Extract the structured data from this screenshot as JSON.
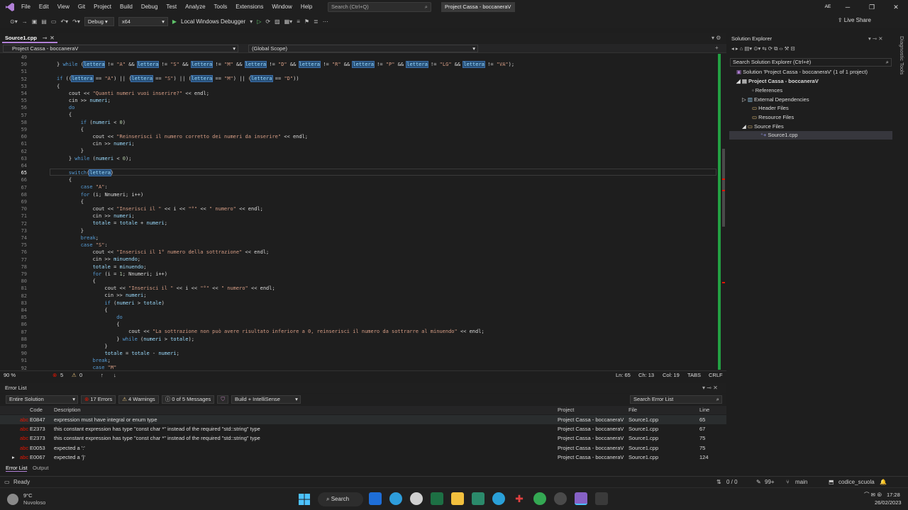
{
  "menubar": {
    "items": [
      "File",
      "Edit",
      "View",
      "Git",
      "Project",
      "Build",
      "Debug",
      "Test",
      "Analyze",
      "Tools",
      "Extensions",
      "Window",
      "Help"
    ],
    "search_placeholder": "Search (Ctrl+Q)",
    "project_title": "Project Cassa - boccaneraV",
    "avatar": "AE"
  },
  "toolbar": {
    "config": "Debug",
    "platform": "x64",
    "run_label": "Local Windows Debugger",
    "live_share": "Live Share"
  },
  "tabs": {
    "active": "Source1.cpp",
    "project_dropdown": "Project Cassa - boccaneraV",
    "scope_dropdown": "(Global Scope)"
  },
  "code": {
    "line_numbers": [
      "49",
      "50",
      "51",
      "52",
      "53",
      "54",
      "55",
      "56",
      "57",
      "58",
      "59",
      "60",
      "61",
      "62",
      "63",
      "64",
      "65",
      "66",
      "67",
      "68",
      "69",
      "70",
      "71",
      "72",
      "73",
      "74",
      "75",
      "76",
      "77",
      "78",
      "79",
      "80",
      "81",
      "82",
      "83",
      "84",
      "85",
      "86",
      "87",
      "88",
      "89",
      "90",
      "91",
      "92"
    ]
  },
  "editor_status": {
    "zoom": "90 %",
    "errors": "5",
    "warnings": "0",
    "ln": "Ln: 65",
    "ch": "Ch: 13",
    "col": "Col: 19",
    "tabs": "TABS",
    "eol": "CRLF"
  },
  "error_list": {
    "title": "Error List",
    "scope": "Entire Solution",
    "errors_btn": "17 Errors",
    "warnings_btn": "4 Warnings",
    "messages_btn": "0 of 5 Messages",
    "build_filter": "Build + IntelliSense",
    "search_placeholder": "Search Error List",
    "headers": {
      "code": "Code",
      "desc": "Description",
      "project": "Project",
      "file": "File",
      "line": "Line"
    },
    "rows": [
      {
        "code": "E0847",
        "desc": "expression must have integral or enum type",
        "project": "Project Cassa - boccaneraV",
        "file": "Source1.cpp",
        "line": "65"
      },
      {
        "code": "E2373",
        "desc": "this constant expression has type \"const char *\" instead of the required \"std::string\" type",
        "project": "Project Cassa - boccaneraV",
        "file": "Source1.cpp",
        "line": "67"
      },
      {
        "code": "E2373",
        "desc": "this constant expression has type \"const char *\" instead of the required \"std::string\" type",
        "project": "Project Cassa - boccaneraV",
        "file": "Source1.cpp",
        "line": "75"
      },
      {
        "code": "E0053",
        "desc": "expected a ':'",
        "project": "Project Cassa - boccaneraV",
        "file": "Source1.cpp",
        "line": "75"
      },
      {
        "code": "E0067",
        "desc": "expected a '}'",
        "project": "Project Cassa - boccaneraV",
        "file": "Source1.cpp",
        "line": "124"
      }
    ],
    "tab_error_list": "Error List",
    "tab_output": "Output"
  },
  "solution_explorer": {
    "title": "Solution Explorer",
    "search_placeholder": "Search Solution Explorer (Ctrl+è)",
    "solution": "Solution 'Project Cassa - boccaneraV' (1 of 1 project)",
    "project": "Project Cassa - boccaneraV",
    "items": [
      "References",
      "External Dependencies",
      "Header Files",
      "Resource Files",
      "Source Files"
    ],
    "file": "Source1.cpp",
    "side_tab": "Diagnostic Tools"
  },
  "statusbar": {
    "ready": "Ready",
    "git_counts": "0 / 0",
    "pencil": "99+",
    "branch": "main",
    "repo": "codice_scuola"
  },
  "taskbar": {
    "temp": "9°C",
    "weather": "Nuvoloso",
    "search": "Search",
    "time": "17:28",
    "date": "26/02/2023"
  }
}
